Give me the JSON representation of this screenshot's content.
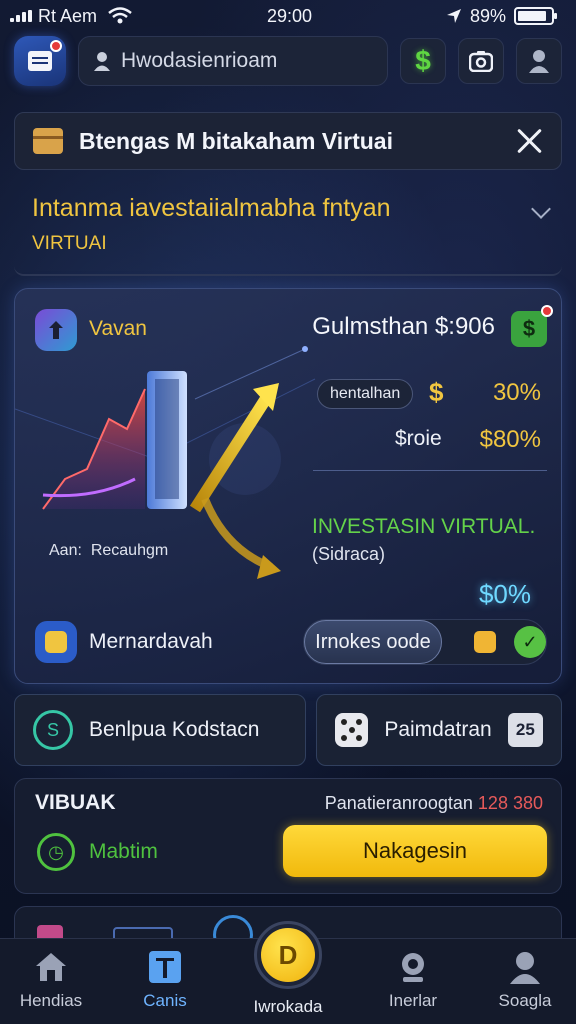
{
  "status_bar": {
    "carrier": "Rt Aem",
    "time": "29:00",
    "battery_text": "89%",
    "battery_level": 0.89
  },
  "top_bar": {
    "app_icon": "document-icon",
    "search_placeholder": "Hwodasienrioam",
    "buttons": [
      "dollar-icon",
      "camera-icon",
      "user-icon"
    ],
    "dollar_glyph": "$"
  },
  "notice": {
    "title": "Btengas M bitakaham Virtuai"
  },
  "headline": {
    "title": "Intanma iavestaiialmabha fntyan",
    "subtitle": "VIRTUAI"
  },
  "main_card": {
    "user_name": "Vavan",
    "balance_label": "Gulmsthan $:906",
    "pill_label": "hentalhan",
    "stat_dollar": "$",
    "stat_pct_1": "30%",
    "stat_label_2": "$roie",
    "stat_pct_2": "$80%",
    "invest_title": "INVESTASIN VIRTUAL.",
    "invest_subtitle": "(Sidraca)",
    "invest_pct": "$0%",
    "axis_left": "Aan:",
    "axis_right": "Recauhgm",
    "footer_name": "Mernardavah",
    "action_button": "Irnokes oode"
  },
  "tiles": {
    "left_label": "Benlpua Kodstacn",
    "right_label": "Paimdatran",
    "right_number": "25"
  },
  "bottom_card": {
    "title": "VIBUAK",
    "right_label": "Panatieranroogtan",
    "right_value": "128 380",
    "item_label": "Mabtim",
    "button_label": "Nakagesin"
  },
  "nav": {
    "items": [
      {
        "label": "Hendias",
        "icon": "home-icon"
      },
      {
        "label": "Canis",
        "icon": "card-icon"
      },
      {
        "label": "Iwrokada",
        "icon": "coin-icon"
      },
      {
        "label": "Inerlar",
        "icon": "camera-icon"
      },
      {
        "label": "Soagla",
        "icon": "user-icon"
      }
    ],
    "center_glyph": "D"
  }
}
